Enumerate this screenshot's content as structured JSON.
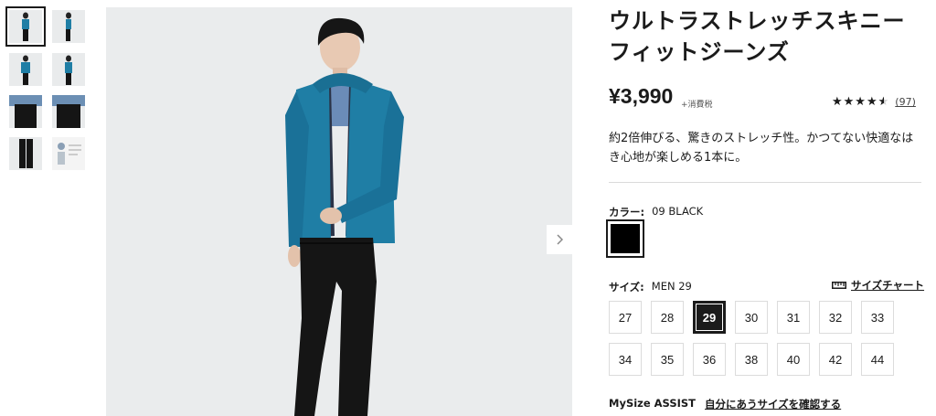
{
  "product": {
    "title_line1": "ウルトラストレッチスキニー",
    "title_line2": "フィットジーンズ",
    "price": "¥3,990",
    "tax_note": "+消費税",
    "rating": {
      "stars_text": "★★★★★",
      "value": 4.5,
      "out_of": 5,
      "review_count": "(97)"
    },
    "description": "約2倍伸びる、驚きのストレッチ性。かつてない快適なはき心地が楽しめる1本に。"
  },
  "color": {
    "label": "カラー:",
    "selected": "09 BLACK",
    "swatch_hex": "#000000"
  },
  "size": {
    "label": "サイズ:",
    "selected": "MEN 29",
    "chart_link": "サイズチャート",
    "chart_icon": "ruler-icon",
    "options": [
      "27",
      "28",
      "29",
      "30",
      "31",
      "32",
      "33",
      "34",
      "35",
      "36",
      "38",
      "40",
      "42",
      "44"
    ],
    "selected_value": "29"
  },
  "mysize": {
    "label": "MySize ASSIST",
    "link": "自分にあうサイズを確認する"
  },
  "gallery": {
    "next_icon": "chevron-right-icon",
    "thumbnail_count": 8,
    "selected_index": 0
  },
  "colors": {
    "jacket": "#1f7ea5",
    "jeans": "#151515",
    "background": "#eaeced"
  }
}
